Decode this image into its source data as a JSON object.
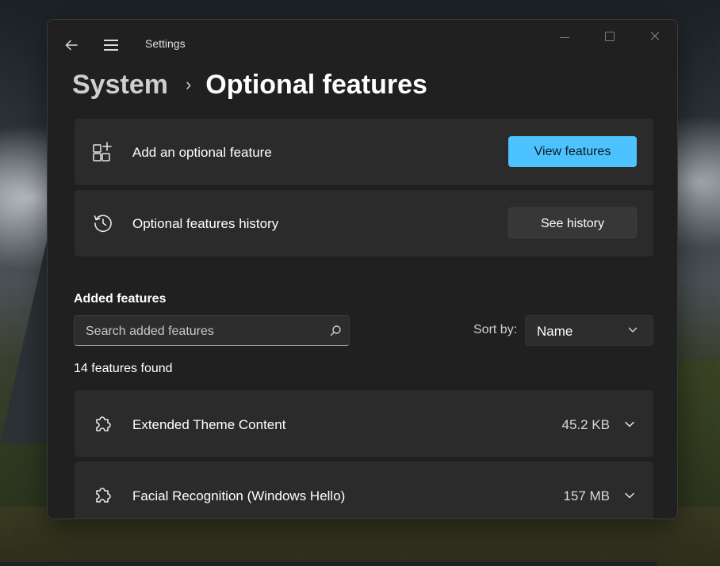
{
  "window": {
    "title": "Settings"
  },
  "breadcrumb": {
    "parent": "System",
    "separator": "›",
    "current": "Optional features"
  },
  "cards": [
    {
      "label": "Add an optional feature",
      "icon": "add-apps-icon",
      "button": "View features"
    },
    {
      "label": "Optional features history",
      "icon": "history-icon",
      "button": "See history"
    }
  ],
  "added": {
    "title": "Added features",
    "search_placeholder": "Search added features",
    "sort_label": "Sort by:",
    "sort_value": "Name",
    "count_text": "14 features found",
    "items": [
      {
        "name": "Extended Theme Content",
        "size": "45.2 KB",
        "icon": "puzzle-icon"
      },
      {
        "name": "Facial Recognition (Windows Hello)",
        "size": "157 MB",
        "icon": "puzzle-icon"
      }
    ]
  },
  "colors": {
    "accent": "#4cc2ff",
    "window_bg": "#202020",
    "card_bg": "#2b2b2b"
  }
}
